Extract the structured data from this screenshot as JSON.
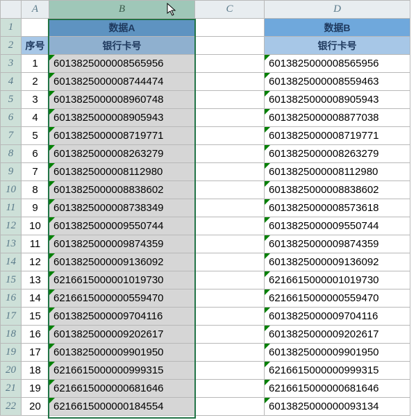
{
  "columns": [
    "A",
    "B",
    "C",
    "D"
  ],
  "selected_column": "B",
  "header_row1": {
    "A": "",
    "B": "数据A",
    "D": "数据B"
  },
  "header_row2": {
    "A": "序号",
    "B": "银行卡号",
    "D": "银行卡号"
  },
  "chart_data": {
    "type": "table",
    "title": "",
    "columns": [
      "序号",
      "数据A 银行卡号",
      "数据B 银行卡号"
    ],
    "rows": [
      [
        1,
        "6013825000008565956",
        "6013825000008565956"
      ],
      [
        2,
        "6013825000008744474",
        "6013825000008559463"
      ],
      [
        3,
        "6013825000008960748",
        "6013825000008905943"
      ],
      [
        4,
        "6013825000008905943",
        "6013825000008877038"
      ],
      [
        5,
        "6013825000008719771",
        "6013825000008719771"
      ],
      [
        6,
        "6013825000008263279",
        "6013825000008263279"
      ],
      [
        7,
        "6013825000008112980",
        "6013825000008112980"
      ],
      [
        8,
        "6013825000008838602",
        "6013825000008838602"
      ],
      [
        9,
        "6013825000008738349",
        "6013825000008573618"
      ],
      [
        10,
        "6013825000009550744",
        "6013825000009550744"
      ],
      [
        11,
        "6013825000009874359",
        "6013825000009874359"
      ],
      [
        12,
        "6013825000009136092",
        "6013825000009136092"
      ],
      [
        13,
        "6216615000001019730",
        "6216615000001019730"
      ],
      [
        14,
        "6216615000000559470",
        "6216615000000559470"
      ],
      [
        15,
        "6013825000009704116",
        "6013825000009704116"
      ],
      [
        16,
        "6013825000009202617",
        "6013825000009202617"
      ],
      [
        17,
        "6013825000009901950",
        "6013825000009901950"
      ],
      [
        18,
        "6216615000000999315",
        "6216615000000999315"
      ],
      [
        19,
        "6216615000000681646",
        "6216615000000681646"
      ],
      [
        20,
        "6216615000000184554",
        "6013825000000093134"
      ]
    ]
  }
}
